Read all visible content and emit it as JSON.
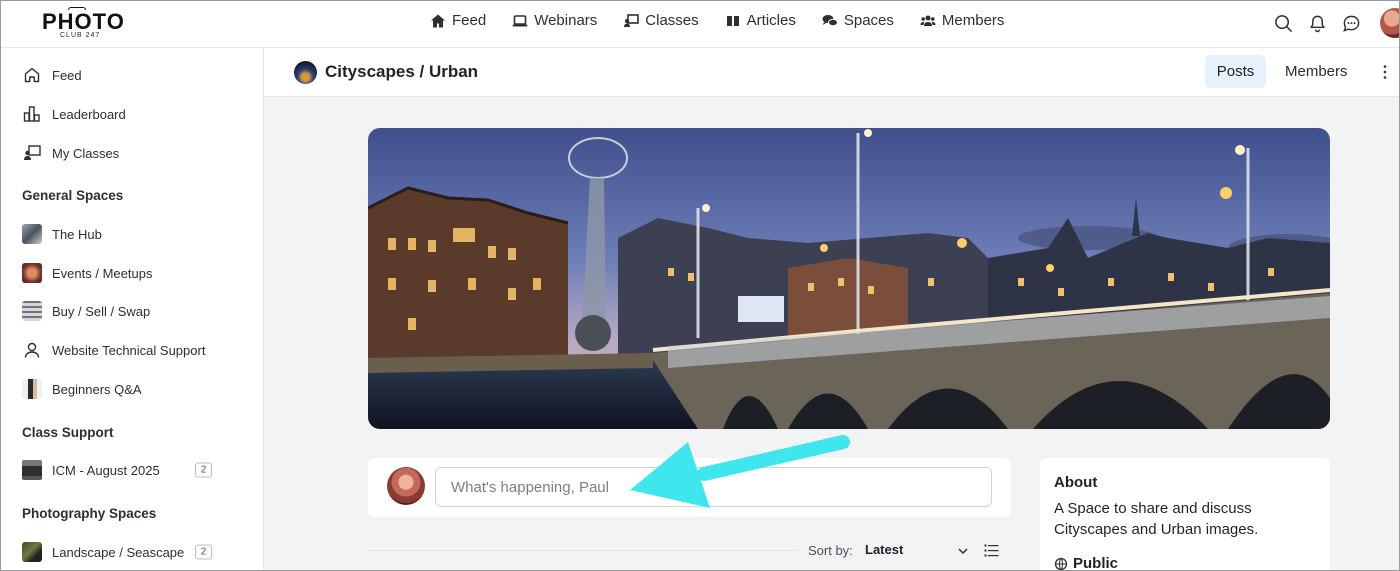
{
  "logo": {
    "brand": "PHOTO",
    "sub": "CLUB 247"
  },
  "nav": [
    {
      "label": "Feed",
      "icon": "home-icon"
    },
    {
      "label": "Webinars",
      "icon": "laptop-icon"
    },
    {
      "label": "Classes",
      "icon": "teacher-icon"
    },
    {
      "label": "Articles",
      "icon": "book-icon"
    },
    {
      "label": "Spaces",
      "icon": "comments-icon"
    },
    {
      "label": "Members",
      "icon": "users-icon"
    }
  ],
  "top_icons": [
    "search-icon",
    "bell-icon",
    "chat-icon",
    "avatar"
  ],
  "sidebar": {
    "items": [
      {
        "label": "Feed",
        "icon": "home-outline-icon"
      },
      {
        "label": "Leaderboard",
        "icon": "chart-bars-icon"
      },
      {
        "label": "My Classes",
        "icon": "teacher-board-icon"
      }
    ],
    "general_heading": "General Spaces",
    "general": [
      {
        "label": "The Hub",
        "icon": "space-thumb-icon"
      },
      {
        "label": "Events / Meetups",
        "icon": "space-thumb-icon"
      },
      {
        "label": "Buy / Sell / Swap",
        "icon": "space-thumb-icon"
      },
      {
        "label": "Website Technical Support",
        "icon": "user-outline-icon"
      },
      {
        "label": "Beginners Q&A",
        "icon": "space-thumb-icon"
      }
    ],
    "class_heading": "Class Support",
    "class_items": [
      {
        "label": "ICM - August 2025",
        "count": "2",
        "icon": "camera-thumb-icon"
      }
    ],
    "photo_heading": "Photography Spaces",
    "photo_items": [
      {
        "label": "Landscape / Seascape",
        "count": "2",
        "icon": "space-thumb-icon"
      }
    ]
  },
  "space": {
    "title": "Cityscapes / Urban",
    "tabs": {
      "posts": "Posts",
      "members": "Members"
    }
  },
  "composer": {
    "placeholder": "What's happening, Paul"
  },
  "sort": {
    "label": "Sort by:",
    "value": "Latest"
  },
  "about": {
    "title": "About",
    "description": "A Space to share and discuss Cityscapes and Urban images.",
    "visibility": "Public"
  },
  "colors": {
    "accent_tab_bg": "#e6f1fb",
    "arrow": "#3fe6ee",
    "page_bg": "#f1f3f5"
  }
}
